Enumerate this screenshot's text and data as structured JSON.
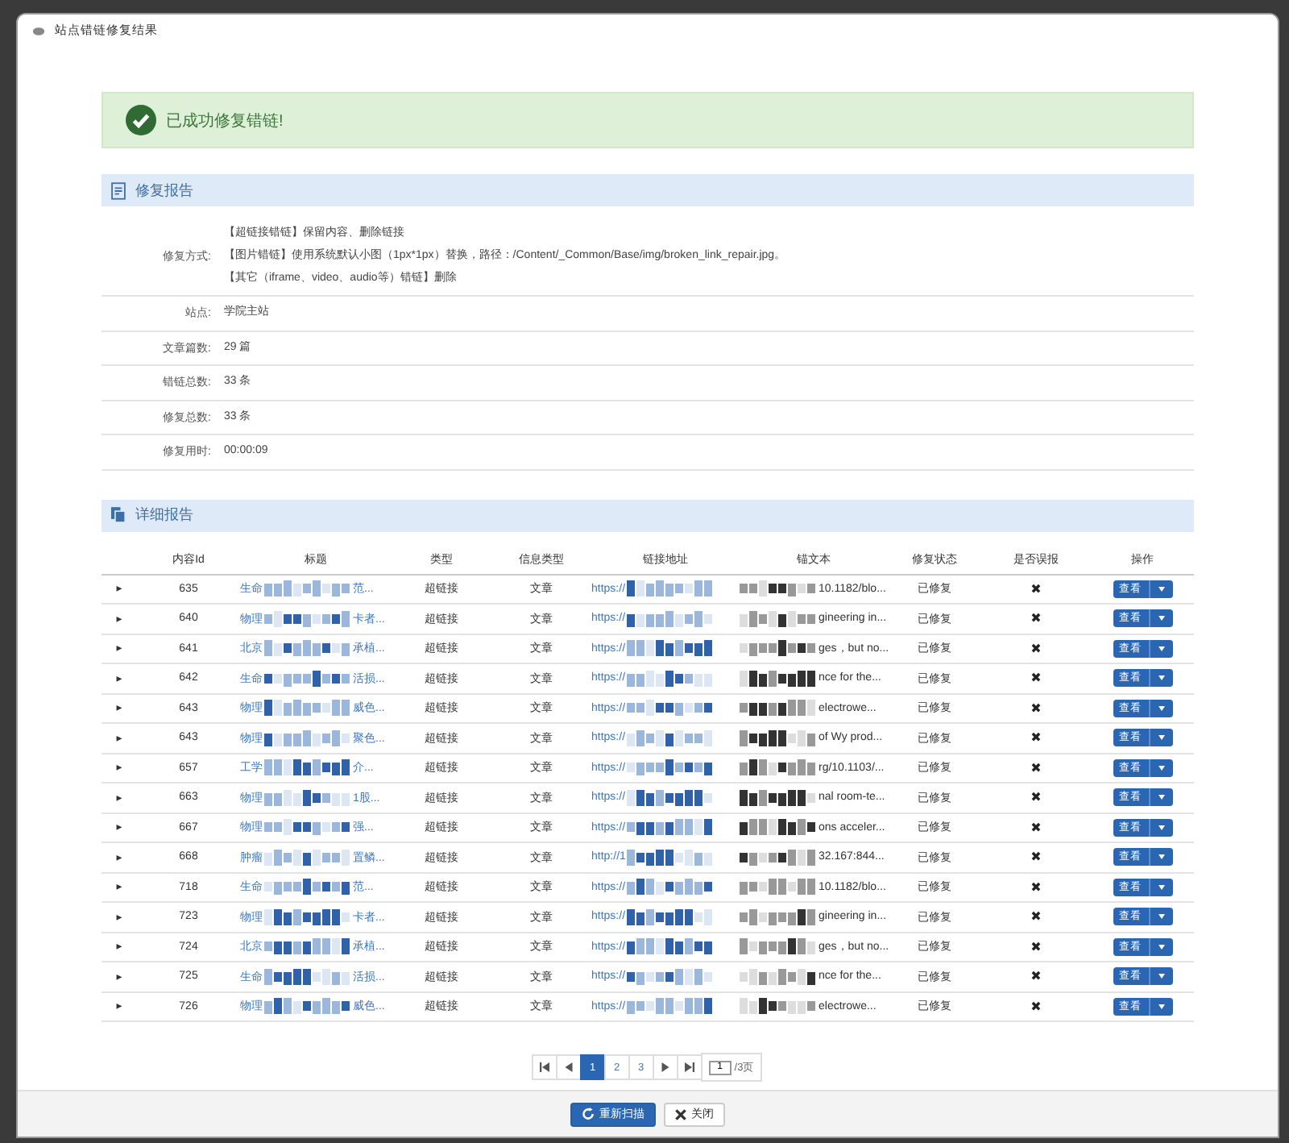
{
  "window": {
    "title": "站点错链修复结果"
  },
  "alert": {
    "message": "已成功修复错链!"
  },
  "report": {
    "title": "修复报告",
    "fields": [
      {
        "label": "修复方式:",
        "lines": [
          "【超链接错链】保留内容、删除链接",
          "【图片错链】使用系统默认小图（1px*1px）替换，路径：/Content/_Common/Base/img/broken_link_repair.jpg。",
          "【其它（iframe、video、audio等）错链】删除"
        ]
      },
      {
        "label": "站点:",
        "lines": [
          "学院主站"
        ]
      },
      {
        "label": "文章篇数:",
        "lines": [
          "29 篇"
        ]
      },
      {
        "label": "错链总数:",
        "lines": [
          "33 条"
        ]
      },
      {
        "label": "修复总数:",
        "lines": [
          "33 条"
        ]
      },
      {
        "label": "修复用时:",
        "lines": [
          "00:00:09"
        ]
      }
    ]
  },
  "detail": {
    "title": "详细报告",
    "columns": [
      "内容Id",
      "标题",
      "类型",
      "信息类型",
      "链接地址",
      "锚文本",
      "修复状态",
      "是否误报",
      "操作"
    ],
    "rows": [
      {
        "expand": "▸",
        "id": "635",
        "title_start": "生命",
        "title_end": "范...",
        "type": "超链接",
        "info_type": "文章",
        "link_start": "https://",
        "anchor_end": "10.1182/blo...",
        "status": "已修复",
        "false_alarm": "✖",
        "action": "查看"
      },
      {
        "expand": "▸",
        "id": "640",
        "title_start": "物理",
        "title_end": "卡者...",
        "type": "超链接",
        "info_type": "文章",
        "link_start": "https://",
        "anchor_end": "gineering in...",
        "status": "已修复",
        "false_alarm": "✖",
        "action": "查看"
      },
      {
        "expand": "▸",
        "id": "641",
        "title_start": "北京",
        "title_end": "承植...",
        "type": "超链接",
        "info_type": "文章",
        "link_start": "https://",
        "anchor_end": "ges，but no...",
        "status": "已修复",
        "false_alarm": "✖",
        "action": "查看"
      },
      {
        "expand": "▸",
        "id": "642",
        "title_start": "生命",
        "title_end": "活损...",
        "type": "超链接",
        "info_type": "文章",
        "link_start": "https://",
        "anchor_end": "nce for the...",
        "status": "已修复",
        "false_alarm": "✖",
        "action": "查看"
      },
      {
        "expand": "▸",
        "id": "643",
        "title_start": "物理",
        "title_end": "威色...",
        "type": "超链接",
        "info_type": "文章",
        "link_start": "https://",
        "anchor_end": "electrowe...",
        "status": "已修复",
        "false_alarm": "✖",
        "action": "查看"
      },
      {
        "expand": "▸",
        "id": "643",
        "title_start": "物理",
        "title_end": "聚色...",
        "type": "超链接",
        "info_type": "文章",
        "link_start": "https://",
        "anchor_end": "of Wy prod...",
        "status": "已修复",
        "false_alarm": "✖",
        "action": "查看"
      },
      {
        "expand": "▸",
        "id": "657",
        "title_start": "工学",
        "title_end": "介...",
        "type": "超链接",
        "info_type": "文章",
        "link_start": "https://",
        "anchor_end": "rg/10.1103/...",
        "status": "已修复",
        "false_alarm": "✖",
        "action": "查看"
      },
      {
        "expand": "▸",
        "id": "663",
        "title_start": "物理",
        "title_end": "1股...",
        "type": "超链接",
        "info_type": "文章",
        "link_start": "https://",
        "anchor_end": "nal room-te...",
        "status": "已修复",
        "false_alarm": "✖",
        "action": "查看"
      },
      {
        "expand": "▸",
        "id": "667",
        "title_start": "物理",
        "title_end": "强...",
        "type": "超链接",
        "info_type": "文章",
        "link_start": "https://",
        "anchor_end": "ons acceler...",
        "status": "已修复",
        "false_alarm": "✖",
        "action": "查看"
      },
      {
        "expand": "▸",
        "id": "668",
        "title_start": "肿瘤",
        "title_end": "置鳞...",
        "type": "超链接",
        "info_type": "文章",
        "link_start": "http://1",
        "anchor_end": "32.167:844...",
        "status": "已修复",
        "false_alarm": "✖",
        "action": "查看"
      },
      {
        "expand": "▸",
        "id": "718",
        "title_start": "生命",
        "title_end": "范...",
        "type": "超链接",
        "info_type": "文章",
        "link_start": "https://",
        "anchor_end": "10.1182/blo...",
        "status": "已修复",
        "false_alarm": "✖",
        "action": "查看"
      },
      {
        "expand": "▸",
        "id": "723",
        "title_start": "物理",
        "title_end": "卡者...",
        "type": "超链接",
        "info_type": "文章",
        "link_start": "https://",
        "anchor_end": "gineering in...",
        "status": "已修复",
        "false_alarm": "✖",
        "action": "查看"
      },
      {
        "expand": "▸",
        "id": "724",
        "title_start": "北京",
        "title_end": "承植...",
        "type": "超链接",
        "info_type": "文章",
        "link_start": "https://",
        "anchor_end": "ges，but no...",
        "status": "已修复",
        "false_alarm": "✖",
        "action": "查看"
      },
      {
        "expand": "▸",
        "id": "725",
        "title_start": "生命",
        "title_end": "活损...",
        "type": "超链接",
        "info_type": "文章",
        "link_start": "https://",
        "anchor_end": "nce for the...",
        "status": "已修复",
        "false_alarm": "✖",
        "action": "查看"
      },
      {
        "expand": "▸",
        "id": "726",
        "title_start": "物理",
        "title_end": "威色...",
        "type": "超链接",
        "info_type": "文章",
        "link_start": "https://",
        "anchor_end": "electrowe...",
        "status": "已修复",
        "false_alarm": "✖",
        "action": "查看"
      }
    ]
  },
  "pagination": {
    "pages": [
      {
        "label": "1",
        "selected": true
      },
      {
        "label": "2",
        "selected": false
      },
      {
        "label": "3",
        "selected": false
      }
    ],
    "page_input": "1",
    "total": "/3页"
  },
  "buttons": [
    {
      "kind": "primary",
      "label": "重新扫描"
    },
    {
      "kind": "default",
      "label": "关闭"
    }
  ]
}
